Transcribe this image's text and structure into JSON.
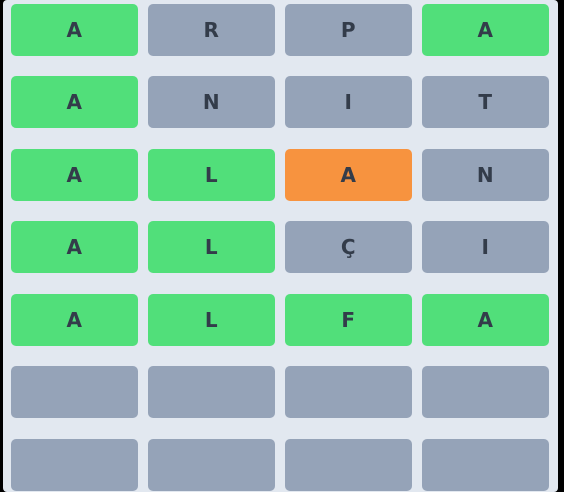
{
  "board": {
    "rows": [
      {
        "tiles": [
          {
            "letter": "A",
            "state": "correct"
          },
          {
            "letter": "R",
            "state": "absent"
          },
          {
            "letter": "P",
            "state": "absent"
          },
          {
            "letter": "A",
            "state": "correct"
          }
        ]
      },
      {
        "tiles": [
          {
            "letter": "A",
            "state": "correct"
          },
          {
            "letter": "N",
            "state": "absent"
          },
          {
            "letter": "I",
            "state": "absent"
          },
          {
            "letter": "T",
            "state": "absent"
          }
        ]
      },
      {
        "tiles": [
          {
            "letter": "A",
            "state": "correct"
          },
          {
            "letter": "L",
            "state": "correct"
          },
          {
            "letter": "A",
            "state": "present"
          },
          {
            "letter": "N",
            "state": "absent"
          }
        ]
      },
      {
        "tiles": [
          {
            "letter": "A",
            "state": "correct"
          },
          {
            "letter": "L",
            "state": "correct"
          },
          {
            "letter": "Ç",
            "state": "absent"
          },
          {
            "letter": "I",
            "state": "absent"
          }
        ]
      },
      {
        "tiles": [
          {
            "letter": "A",
            "state": "correct"
          },
          {
            "letter": "L",
            "state": "correct"
          },
          {
            "letter": "F",
            "state": "correct"
          },
          {
            "letter": "A",
            "state": "correct"
          }
        ]
      },
      {
        "tiles": [
          {
            "letter": "",
            "state": "empty"
          },
          {
            "letter": "",
            "state": "empty"
          },
          {
            "letter": "",
            "state": "empty"
          },
          {
            "letter": "",
            "state": "empty"
          }
        ]
      },
      {
        "tiles": [
          {
            "letter": "",
            "state": "empty"
          },
          {
            "letter": "",
            "state": "empty"
          },
          {
            "letter": "",
            "state": "empty"
          },
          {
            "letter": "",
            "state": "empty"
          }
        ]
      }
    ]
  },
  "colors": {
    "correct": "#51df7a",
    "absent": "#95a3b8",
    "present": "#f7933f",
    "board_background": "#e2e8f0",
    "letter": "#333c4a"
  }
}
